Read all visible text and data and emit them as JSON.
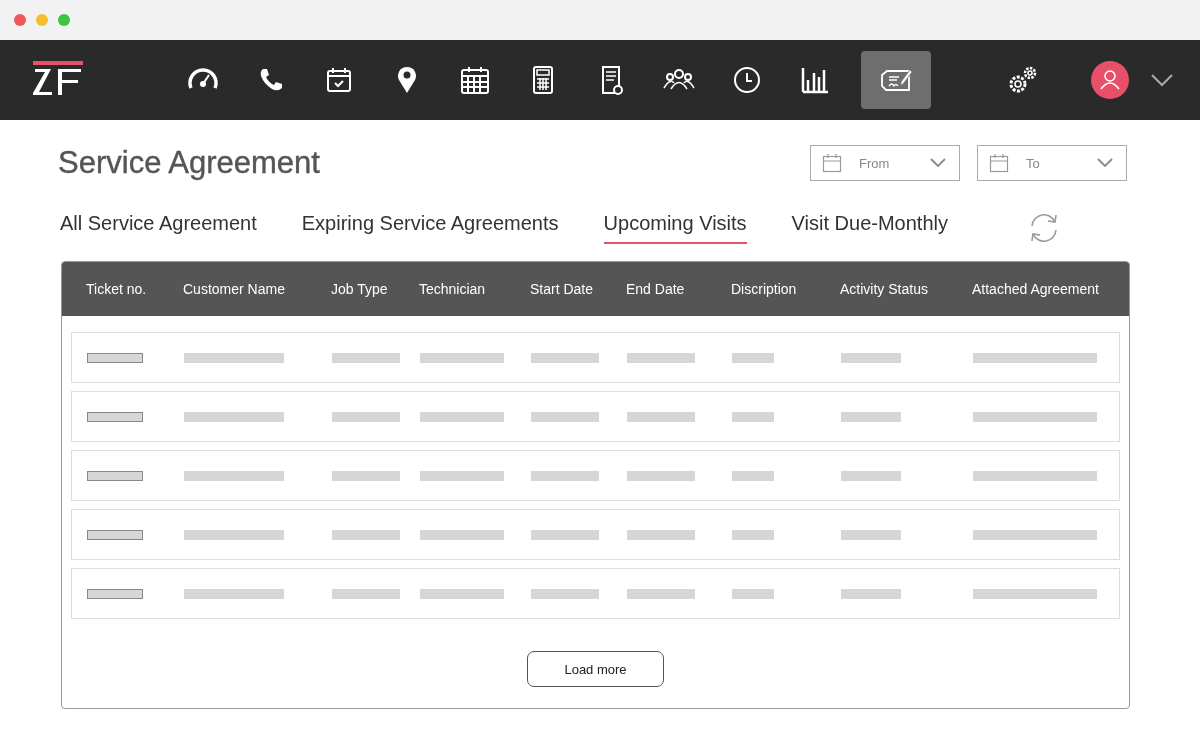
{
  "nav_items": [
    {
      "selected": false
    },
    {
      "selected": false
    },
    {
      "selected": false
    },
    {
      "selected": false
    },
    {
      "selected": false
    },
    {
      "selected": false
    },
    {
      "selected": false
    },
    {
      "selected": false
    },
    {
      "selected": false
    },
    {
      "selected": false
    },
    {
      "selected": true
    }
  ],
  "page_title": "Service Agreement",
  "date_filters": [
    {
      "placeholder": "From"
    },
    {
      "placeholder": "To"
    }
  ],
  "tabs": [
    {
      "label": "All Service Agreement",
      "selected": false
    },
    {
      "label": "Expiring Service Agreements",
      "selected": false
    },
    {
      "label": "Upcoming Visits",
      "selected": true
    },
    {
      "label": "Visit Due-Monthly",
      "selected": false
    }
  ],
  "table": {
    "columns": [
      "Ticket no.",
      "Customer Name",
      "Job Type",
      "Technician",
      "Start Date",
      "End Date",
      "Discription",
      "Activity Status",
      "Attached Agreement"
    ],
    "rows": [
      {
        "kind": "placeholder"
      },
      {
        "kind": "placeholder"
      },
      {
        "kind": "placeholder"
      },
      {
        "kind": "placeholder"
      },
      {
        "kind": "placeholder"
      }
    ]
  },
  "load_more": "Load more"
}
